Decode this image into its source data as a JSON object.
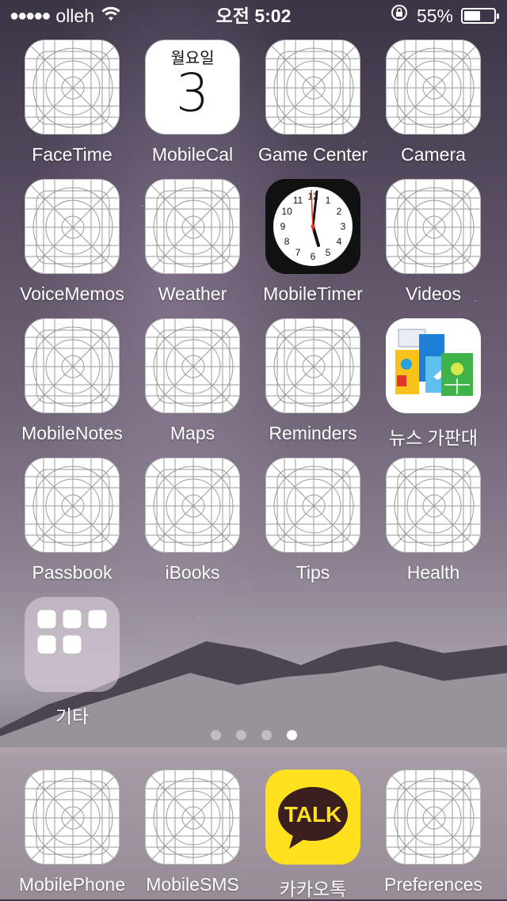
{
  "status_bar": {
    "signal": "●●●●●",
    "carrier": "olleh",
    "time": "오전 5:02",
    "battery_percent": "55%",
    "battery_level": 0.55
  },
  "home": {
    "apps": [
      {
        "label": "FaceTime",
        "icon": "placeholder-grid-icon"
      },
      {
        "label": "MobileCal",
        "icon": "calendar-icon",
        "weekday": "월요일",
        "day": "3"
      },
      {
        "label": "Game Center",
        "icon": "placeholder-grid-icon"
      },
      {
        "label": "Camera",
        "icon": "placeholder-grid-icon"
      },
      {
        "label": "VoiceMemos",
        "icon": "placeholder-grid-icon"
      },
      {
        "label": "Weather",
        "icon": "placeholder-grid-icon"
      },
      {
        "label": "MobileTimer",
        "icon": "clock-icon"
      },
      {
        "label": "Videos",
        "icon": "placeholder-grid-icon"
      },
      {
        "label": "MobileNotes",
        "icon": "placeholder-grid-icon"
      },
      {
        "label": "Maps",
        "icon": "placeholder-grid-icon"
      },
      {
        "label": "Reminders",
        "icon": "placeholder-grid-icon"
      },
      {
        "label": "뉴스 가판대",
        "icon": "newsstand-icon"
      },
      {
        "label": "Passbook",
        "icon": "placeholder-grid-icon"
      },
      {
        "label": "iBooks",
        "icon": "placeholder-grid-icon"
      },
      {
        "label": "Tips",
        "icon": "placeholder-grid-icon"
      },
      {
        "label": "Health",
        "icon": "placeholder-grid-icon"
      },
      {
        "label": "기타",
        "icon": "folder-icon"
      }
    ],
    "clock_numbers": [
      "12",
      "1",
      "2",
      "3",
      "4",
      "5",
      "6",
      "7",
      "8",
      "9",
      "10",
      "11"
    ],
    "page_count": 4,
    "active_page": 4
  },
  "dock": {
    "apps": [
      {
        "label": "MobilePhone",
        "icon": "placeholder-grid-icon"
      },
      {
        "label": "MobileSMS",
        "icon": "placeholder-grid-icon"
      },
      {
        "label": "카카오톡",
        "icon": "kakaotalk-icon",
        "badge_text": "TALK"
      },
      {
        "label": "Preferences",
        "icon": "placeholder-grid-icon"
      }
    ]
  }
}
